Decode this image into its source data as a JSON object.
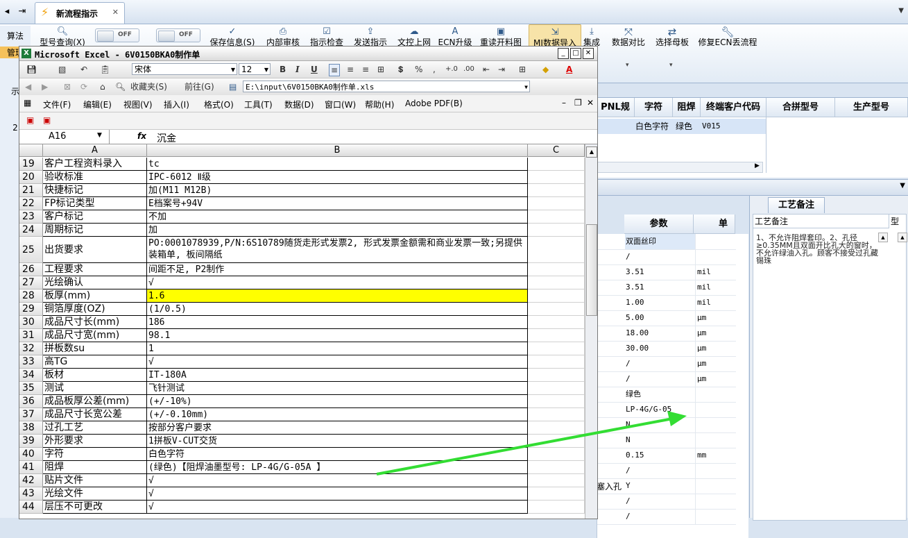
{
  "app": {
    "left_nav": [
      "算法",
      "管理",
      "示",
      "2"
    ],
    "tab_title": "新流程指示",
    "toggles": [
      "OFF",
      "OFF"
    ],
    "ribbon_top_buttons": [
      "型号查询(X)",
      "保存信息(S)",
      "内部审核",
      "指示检查",
      "发送指示",
      "文控上网",
      "ECN升级",
      "重读开料图",
      "MI数据导入",
      "集成"
    ],
    "ribbon_big_buttons": [
      "数据对比",
      "选择母板",
      "修复ECN丢流程"
    ],
    "dropdown_glyph": "▾"
  },
  "excel": {
    "title": "Microsoft Excel - 6V0150BKA0制作单",
    "font_name": "宋体",
    "font_size": "12",
    "format_glyphs": [
      "B",
      "I",
      "U",
      "%",
      ","
    ],
    "nav_labels": {
      "favorites": "收藏夹(S)",
      "goto": "前往(G)"
    },
    "address": "E:\\input\\6V0150BKA0制作单.xls",
    "menus": [
      "文件(F)",
      "编辑(E)",
      "视图(V)",
      "插入(I)",
      "格式(O)",
      "工具(T)",
      "数据(D)",
      "窗口(W)",
      "帮助(H)",
      "Adobe PDF(B)"
    ],
    "name_box": "A16",
    "fx": "fx",
    "formula_value": "沉金",
    "columns": [
      "A",
      "B",
      "C"
    ],
    "rows": [
      {
        "n": "19",
        "a": "客户工程资料录入",
        "b": "tc"
      },
      {
        "n": "20",
        "a": "验收标准",
        "b": "IPC-6012 Ⅱ级"
      },
      {
        "n": "21",
        "a": "快捷标记",
        "b": "加(M11 M12B)"
      },
      {
        "n": "22",
        "a": "FP标记类型",
        "b": "E档案号+94V"
      },
      {
        "n": "23",
        "a": "客户标记",
        "b": "不加"
      },
      {
        "n": "24",
        "a": "周期标记",
        "b": "加"
      },
      {
        "n": "25",
        "a": "出货要求",
        "b": "PO:0001078939,P/N:6S10789随货走形式发票2, 形式发票金额需和商业发票一致;另提供装箱单, 板间隔纸",
        "tall": true
      },
      {
        "n": "26",
        "a": "工程要求",
        "b": "间距不足, P2制作"
      },
      {
        "n": "27",
        "a": "光绘确认",
        "b": "√"
      },
      {
        "n": "28",
        "a": "板厚(mm)",
        "b": "1.6",
        "highlight": true
      },
      {
        "n": "29",
        "a": "铜箔厚度(OZ)",
        "b": " (1/0.5)"
      },
      {
        "n": "30",
        "a": "成品尺寸长(mm)",
        "b": "186"
      },
      {
        "n": "31",
        "a": "成品尺寸宽(mm)",
        "b": "98.1"
      },
      {
        "n": "32",
        "a": "拼板数su",
        "b": "1"
      },
      {
        "n": "33",
        "a": "高TG",
        "b": "√"
      },
      {
        "n": "34",
        "a": "板材",
        "b": "IT-180A"
      },
      {
        "n": "35",
        "a": "测试",
        "b": "飞针测试"
      },
      {
        "n": "36",
        "a": "成品板厚公差(mm)",
        "b": "(+/-10%)"
      },
      {
        "n": "37",
        "a": "成品尺寸长宽公差",
        "b": "(+/-0.10mm)"
      },
      {
        "n": "38",
        "a": "过孔工艺",
        "b": "按部分客户要求"
      },
      {
        "n": "39",
        "a": "外形要求",
        "b": "1拼板V-CUT交货"
      },
      {
        "n": "40",
        "a": "字符",
        "b": "白色字符"
      },
      {
        "n": "41",
        "a": "阻焊",
        "b": "(绿色)【阻焊油墨型号: LP-4G/G-05A 】"
      },
      {
        "n": "42",
        "a": "贴片文件",
        "b": "√"
      },
      {
        "n": "43",
        "a": "光绘文件",
        "b": "√"
      },
      {
        "n": "44",
        "a": "层压不可更改",
        "b": "√"
      }
    ]
  },
  "right_table": {
    "headers": [
      "PNL规格",
      "字符",
      "阻焊",
      "终端客户代码",
      "合拼型号",
      "生产型号"
    ],
    "row": [
      "白色字符",
      "绿色",
      "V015"
    ]
  },
  "params": {
    "headers": [
      "参数",
      "单位"
    ],
    "rows": [
      {
        "p": "双面丝印",
        "u": "",
        "sel": true
      },
      {
        "p": "/",
        "u": ""
      },
      {
        "p": "3.51",
        "u": "mil"
      },
      {
        "p": "3.51",
        "u": "mil"
      },
      {
        "p": "1.00",
        "u": "mil"
      },
      {
        "p": "5.00",
        "u": "μm"
      },
      {
        "p": "18.00",
        "u": "μm"
      },
      {
        "p": "30.00",
        "u": "μm"
      },
      {
        "p": "/",
        "u": "μm"
      },
      {
        "p": "/",
        "u": "μm"
      },
      {
        "p": "绿色",
        "u": ""
      },
      {
        "p": "LP-4G/G-05",
        "u": ""
      },
      {
        "p": "N",
        "u": ""
      },
      {
        "p": "N",
        "u": ""
      },
      {
        "p": "0.15",
        "u": "mm"
      },
      {
        "p": "/",
        "u": ""
      },
      {
        "p": "Y",
        "u": ""
      },
      {
        "p": "/",
        "u": ""
      },
      {
        "p": "/",
        "u": ""
      }
    ],
    "left_fragment": "塞入孔"
  },
  "notes": {
    "tab": "工艺备注",
    "col_header": "工艺备注",
    "col2": "型",
    "text": "1、不允许阻焊套印。2、孔径≥0.35MM且双面开比孔大的窗时，不允许绿油入孔。顾客不接受过孔藏锡珠"
  },
  "colors": {
    "accent": "#2f5a8a",
    "highlight": "#ffff00",
    "arrow": "#33dd33"
  }
}
